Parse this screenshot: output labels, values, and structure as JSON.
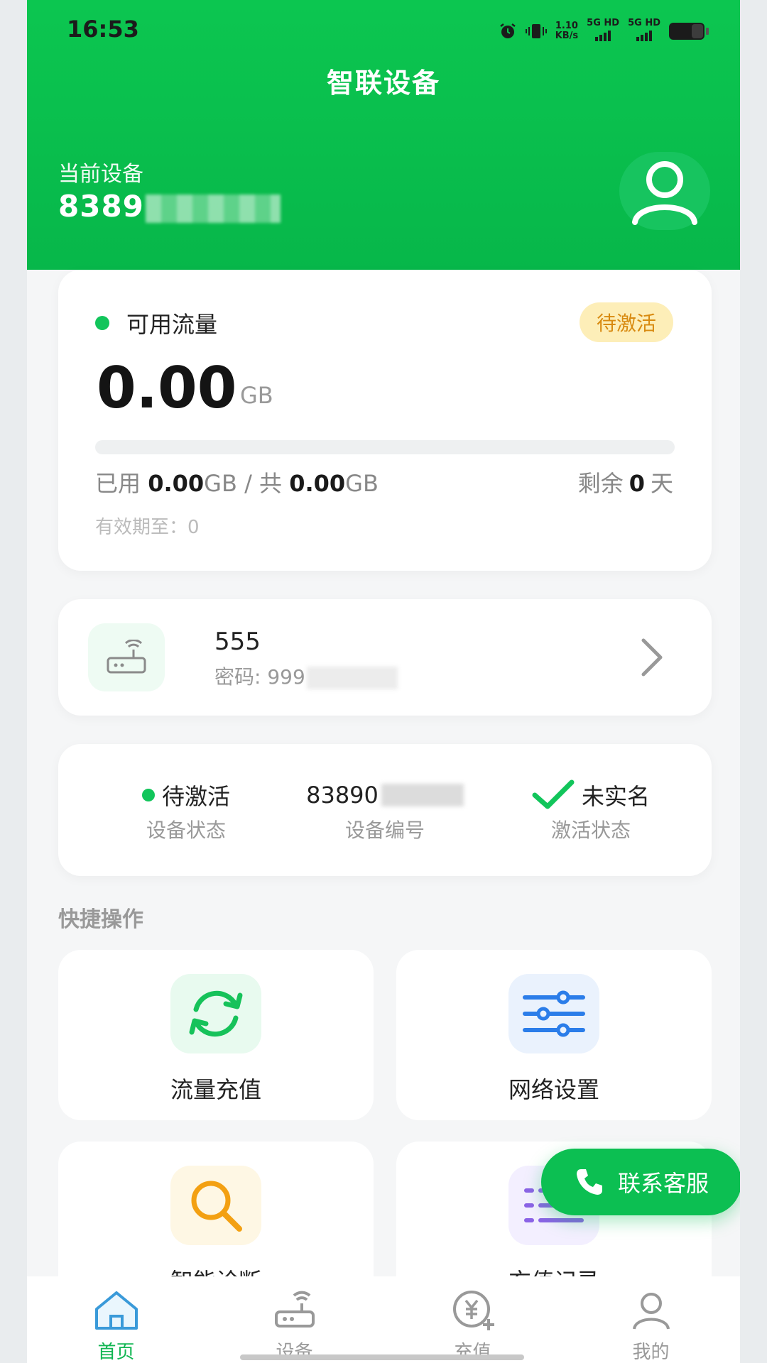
{
  "status_bar": {
    "time": "16:53",
    "net_speed_value": "1.10",
    "net_speed_unit": "KB/s",
    "sim1": "5G HD",
    "sim2": "5G HD"
  },
  "header": {
    "title": "智联设备",
    "current_device_label": "当前设备",
    "current_device_number": "8389"
  },
  "traffic": {
    "label": "可用流量",
    "badge": "待激活",
    "value": "0.00",
    "unit": "GB",
    "usage_fraction": 0,
    "used_label": "已用",
    "used_value": "0.00",
    "used_unit": "GB",
    "separator": "/ 共",
    "total_value": "0.00",
    "total_unit": "GB",
    "remain_label": "剩余",
    "remain_value": "0",
    "remain_unit": "天",
    "expire_text": "有效期至：0"
  },
  "wifi": {
    "name": "555",
    "password_label": "密码: 999"
  },
  "device_status": {
    "state_value": "待激活",
    "state_label": "设备状态",
    "number_value": "83890",
    "number_label": "设备编号",
    "realname_value": "未实名",
    "activation_label": "激活状态"
  },
  "quick_actions": {
    "title": "快捷操作",
    "items": [
      {
        "label": "流量充值",
        "icon": "refresh-icon"
      },
      {
        "label": "网络设置",
        "icon": "sliders-icon"
      },
      {
        "label": "智能诊断",
        "icon": "search-icon"
      },
      {
        "label": "充值记录",
        "icon": "list-icon"
      }
    ]
  },
  "fab": {
    "label": "联系客服",
    "icon": "phone-icon"
  },
  "tabbar": {
    "items": [
      {
        "label": "首页",
        "icon": "home-icon",
        "active": true
      },
      {
        "label": "设备",
        "icon": "router-icon",
        "active": false
      },
      {
        "label": "充值",
        "icon": "yuan-plus-icon",
        "active": false
      },
      {
        "label": "我的",
        "icon": "user-icon",
        "active": false
      }
    ]
  },
  "colors": {
    "brand_green": "#0cc650",
    "badge_bg": "#fdeeb8",
    "badge_text": "#d88a10",
    "active_tab": "#12b653"
  }
}
